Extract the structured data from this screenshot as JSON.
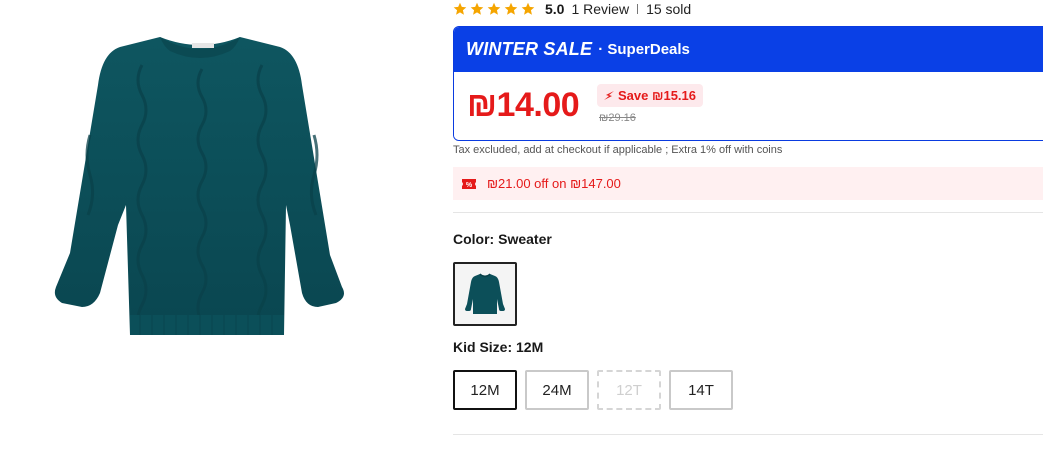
{
  "product": {
    "image_icon": "sweater-image"
  },
  "rating": {
    "stars": 5,
    "value": "5.0",
    "reviews": "1 Review",
    "sold": "15 sold",
    "star_color": "#f5a500"
  },
  "deal": {
    "sale_label": "WINTER SALE",
    "deal_label": "· SuperDeals",
    "price": "₪14.00",
    "save_label": "Save ₪15.16",
    "original_price": "₪29.16",
    "header_color": "#0a40e6",
    "price_color": "#e51a1a"
  },
  "tax_note": "Tax excluded, add at checkout if applicable ; Extra 1% off with coins",
  "coupon": {
    "text": "₪21.00 off on ₪147.00",
    "icon": "coupon-icon"
  },
  "color": {
    "label": "Color: Sweater",
    "swatch_icon": "sweater-swatch"
  },
  "size": {
    "label": "Kid Size: 12M",
    "options": [
      {
        "label": "12M",
        "state": "selected"
      },
      {
        "label": "24M",
        "state": "available"
      },
      {
        "label": "12T",
        "state": "unavailable"
      },
      {
        "label": "14T",
        "state": "available"
      }
    ]
  }
}
